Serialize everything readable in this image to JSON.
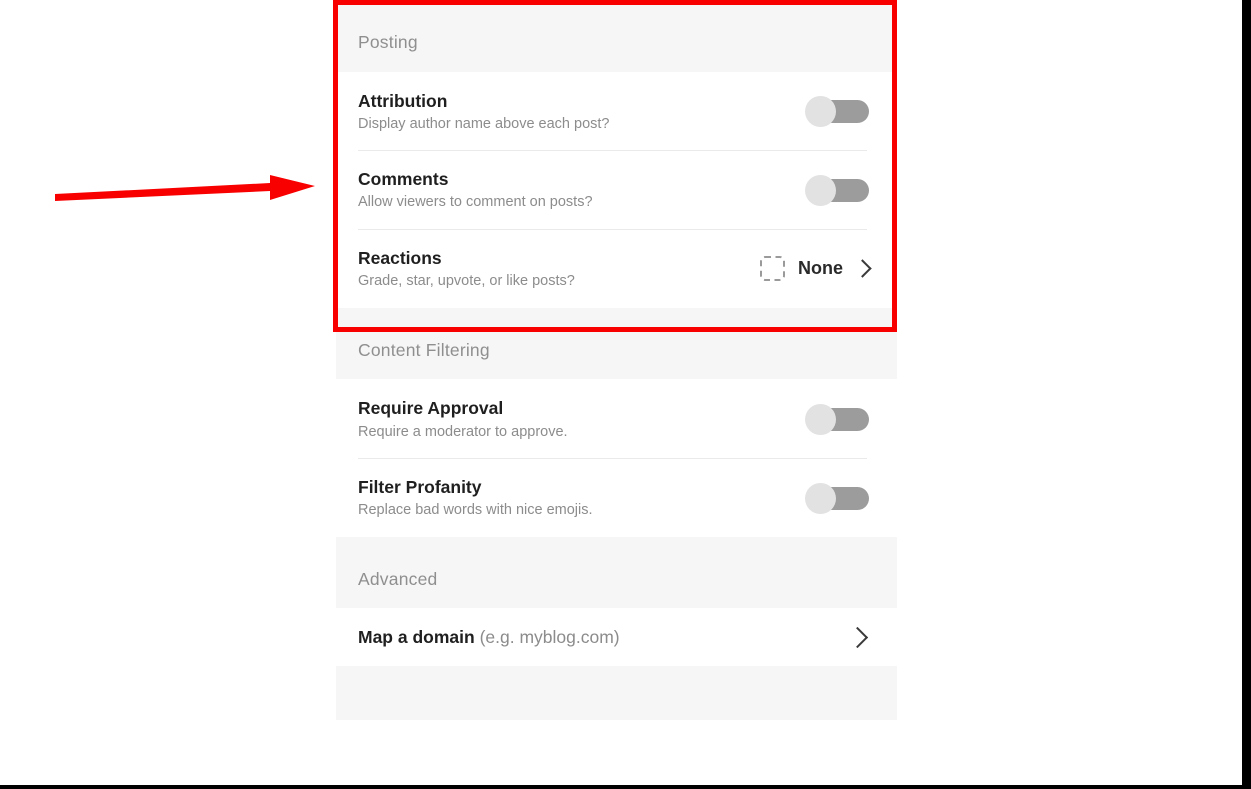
{
  "panel": {
    "sections": [
      {
        "id": "posting",
        "title": "Posting",
        "rows": [
          {
            "id": "attribution",
            "label": "Attribution",
            "description": "Display author name above each post?",
            "control": "toggle",
            "value": "off"
          },
          {
            "id": "comments",
            "label": "Comments",
            "description": "Allow viewers to comment on posts?",
            "control": "toggle",
            "value": "off"
          },
          {
            "id": "reactions",
            "label": "Reactions",
            "description": "Grade, star, upvote, or like posts?",
            "control": "value-chevron",
            "value": "None",
            "icon": "dashed-square-placeholder-icon",
            "chevron": "chevron-right-icon"
          }
        ]
      },
      {
        "id": "content-filtering",
        "title": "Content Filtering",
        "rows": [
          {
            "id": "require-approval",
            "label": "Require Approval",
            "description": "Require a moderator to approve.",
            "control": "toggle",
            "value": "off"
          },
          {
            "id": "filter-profanity",
            "label": "Filter Profanity",
            "description": "Replace bad words with nice emojis.",
            "control": "toggle",
            "value": "off"
          }
        ]
      },
      {
        "id": "advanced",
        "title": "Advanced",
        "rows": [
          {
            "id": "map-a-domain",
            "label": "Map a domain",
            "hint": "(e.g. myblog.com)",
            "control": "chevron",
            "chevron": "chevron-right-icon"
          }
        ]
      }
    ]
  },
  "annotations": {
    "highlight_color": "#f80000",
    "arrow_color": "#f80000",
    "arrow_icon": "red-arrow-right-annotation",
    "highlight_icon": "red-rectangle-annotation"
  },
  "colors": {
    "section_header_bg": "#f6f6f6",
    "panel_bg": "#ffffff",
    "toggle_track_off": "#9c9c9c",
    "toggle_knob_off": "#e2e2e2",
    "label_text": "#1f1f1f",
    "description_text": "#8c8c8c",
    "section_title_text": "#8f8f8f",
    "divider": "#eaeaea",
    "page_border": "#000000"
  }
}
